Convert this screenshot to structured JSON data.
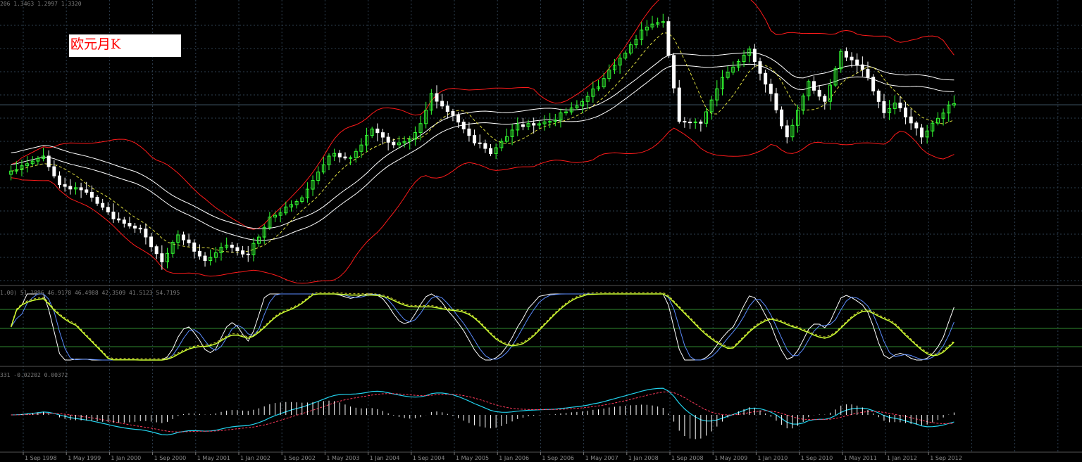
{
  "chart_label": "欧元月K",
  "readouts": {
    "main": "206 1.3463 1.2997 1.3320",
    "stochastic": "1.00) 51.1896 46.9178 46.4988 42.3509 41.5123 54.7195",
    "macd": "331 -0.02202 0.00372"
  },
  "colors": {
    "background": "#000000",
    "grid": "#2e3f4f",
    "bull_candle": "#33ff33",
    "bear_candle": "#ffffff",
    "bollinger": "#ff1a1a",
    "ma_white": "#ffffff",
    "ma_yellow": "#e0e040",
    "stoch_main": "#ffffff",
    "stoch_blue": "#5b8cff",
    "stoch_signal": "#ccff33",
    "stoch_levels": "#2f8a2f",
    "macd_line": "#22d3ee",
    "macd_signal": "#ff3b5c",
    "macd_hist": "#ffffff"
  },
  "chart_data": {
    "type": "candlestick",
    "x_tick_labels": [
      "1 Sep 1998",
      "1 May 1999",
      "1 Jan 2000",
      "1 Sep 2000",
      "1 May 2001",
      "1 Jan 2002",
      "1 Sep 2002",
      "1 May 2003",
      "1 Jan 2004",
      "1 Sep 2004",
      "1 May 2005",
      "1 Jan 2006",
      "1 Sep 2006",
      "1 May 2007",
      "1 Jan 2008",
      "1 Sep 2008",
      "1 May 2009",
      "1 Jan 2010",
      "1 Sep 2010",
      "1 May 2011",
      "1 Jan 2012",
      "1 Sep 2012"
    ],
    "anchor_closes": [
      [
        "1998-06",
        1.12
      ],
      [
        "1998-12",
        1.17
      ],
      [
        "1999-03",
        1.08
      ],
      [
        "1999-08",
        1.06
      ],
      [
        "2000-01",
        0.98
      ],
      [
        "2000-06",
        0.95
      ],
      [
        "2000-10",
        0.85
      ],
      [
        "2001-01",
        0.93
      ],
      [
        "2001-06",
        0.85
      ],
      [
        "2001-10",
        0.9
      ],
      [
        "2002-02",
        0.87
      ],
      [
        "2002-06",
        0.98
      ],
      [
        "2002-12",
        1.04
      ],
      [
        "2003-05",
        1.17
      ],
      [
        "2003-09",
        1.16
      ],
      [
        "2004-01",
        1.25
      ],
      [
        "2004-05",
        1.2
      ],
      [
        "2004-09",
        1.23
      ],
      [
        "2004-12",
        1.35
      ],
      [
        "2005-04",
        1.29
      ],
      [
        "2005-08",
        1.21
      ],
      [
        "2005-11",
        1.18
      ],
      [
        "2006-04",
        1.26
      ],
      [
        "2006-10",
        1.27
      ],
      [
        "2007-03",
        1.32
      ],
      [
        "2007-07",
        1.38
      ],
      [
        "2007-11",
        1.46
      ],
      [
        "2008-04",
        1.56
      ],
      [
        "2008-07",
        1.57
      ],
      [
        "2008-10",
        1.27
      ],
      [
        "2009-02",
        1.27
      ],
      [
        "2009-06",
        1.4
      ],
      [
        "2009-11",
        1.49
      ],
      [
        "2010-03",
        1.35
      ],
      [
        "2010-06",
        1.22
      ],
      [
        "2010-10",
        1.39
      ],
      [
        "2011-01",
        1.33
      ],
      [
        "2011-04",
        1.48
      ],
      [
        "2011-08",
        1.43
      ],
      [
        "2011-12",
        1.3
      ],
      [
        "2012-02",
        1.33
      ],
      [
        "2012-07",
        1.23
      ],
      [
        "2012-11",
        1.3
      ],
      [
        "2013-01",
        1.33
      ]
    ]
  }
}
